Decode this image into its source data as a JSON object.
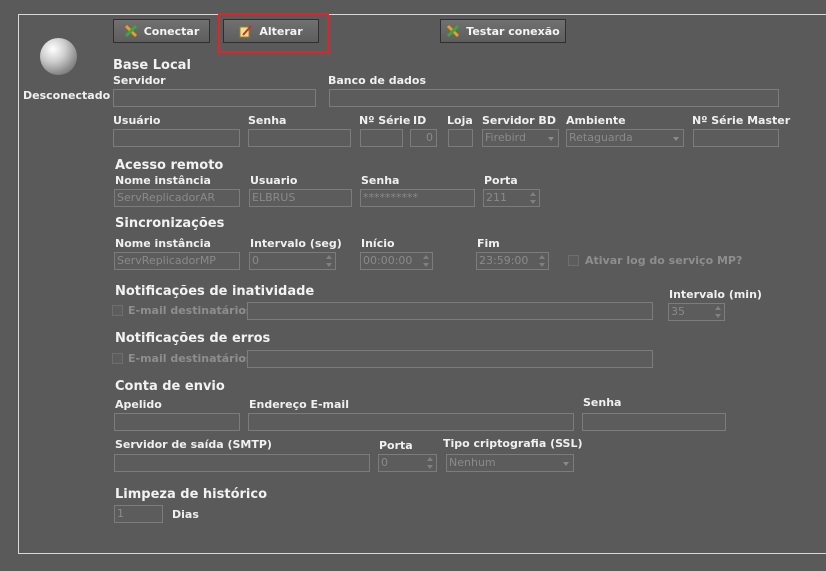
{
  "toolbar": {
    "connect_label": "Conectar",
    "alter_label": "Alterar",
    "test_label": "Testar conexão"
  },
  "status": {
    "text": "Desconectado"
  },
  "base_local": {
    "title": "Base Local",
    "servidor_label": "Servidor",
    "servidor_value": "",
    "banco_label": "Banco de dados",
    "banco_value": "",
    "usuario_label": "Usuário",
    "usuario_value": "",
    "senha_label": "Senha",
    "senha_value": "",
    "nserie_label": "Nº Série",
    "nserie_value": "",
    "id_label": "ID",
    "id_value": "0",
    "loja_label": "Loja",
    "loja_value": "",
    "servidor_bd_label": "Servidor BD",
    "servidor_bd_value": "Firebird",
    "ambiente_label": "Ambiente",
    "ambiente_value": "Retaguarda",
    "nserie_master_label": "Nº Série Master",
    "nserie_master_value": ""
  },
  "acesso_remoto": {
    "title": "Acesso remoto",
    "instancia_label": "Nome instância",
    "instancia_value": "ServReplicadorAR",
    "usuario_label": "Usuario",
    "usuario_value": "ELBRUS",
    "senha_label": "Senha",
    "senha_value": "**********",
    "porta_label": "Porta",
    "porta_value": "211"
  },
  "sincronizacoes": {
    "title": "Sincronizações",
    "instancia_label": "Nome instância",
    "instancia_value": "ServReplicadorMP",
    "intervalo_label": "Intervalo (seg)",
    "intervalo_value": "0",
    "inicio_label": "Início",
    "inicio_value": "00:00:00",
    "fim_label": "Fim",
    "fim_value": "23:59:00",
    "log_label": "Ativar log do serviço MP?"
  },
  "notif_inatividade": {
    "title": "Notificações de inatividade",
    "email_label": "E-mail destinatários",
    "email_value": "",
    "intervalo_label": "Intervalo (min)",
    "intervalo_value": "35"
  },
  "notif_erros": {
    "title": "Notificações de erros",
    "email_label": "E-mail destinatários",
    "email_value": ""
  },
  "conta_envio": {
    "title": "Conta de envio",
    "apelido_label": "Apelido",
    "apelido_value": "",
    "email_label": "Endereço E-mail",
    "email_value": "",
    "senha_label": "Senha",
    "senha_value": "",
    "smtp_label": "Servidor de saída (SMTP)",
    "smtp_value": "",
    "porta_label": "Porta",
    "porta_value": "0",
    "cripto_label": "Tipo criptografia (SSL)",
    "cripto_value": "Nenhum"
  },
  "limpeza": {
    "title": "Limpeza de histórico",
    "dias_value": "1",
    "dias_label": "Dias"
  }
}
